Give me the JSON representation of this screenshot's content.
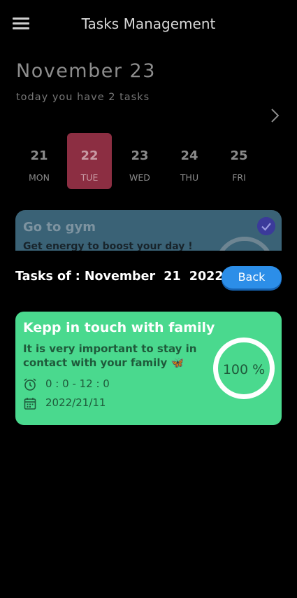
{
  "app": {
    "title": "Tasks Management"
  },
  "header": {
    "date": "November 23",
    "subtitle": "today you have 2 tasks"
  },
  "days": [
    {
      "num": "21",
      "dow": "MON",
      "selected": false
    },
    {
      "num": "22",
      "dow": "TUE",
      "selected": true
    },
    {
      "num": "23",
      "dow": "WED",
      "selected": false
    },
    {
      "num": "24",
      "dow": "THU",
      "selected": false
    },
    {
      "num": "25",
      "dow": "FRI",
      "selected": false
    }
  ],
  "peek_card": {
    "title": "Go to gym",
    "description": "Get energy to boost your day !"
  },
  "overlay": {
    "title": "Tasks of : November  21  2022",
    "back_label": "Back"
  },
  "task": {
    "title": "Kepp in touch with family",
    "description": "It is very important to stay in contact with your family 🦋",
    "time": "0 : 0 - 12 : 0",
    "date": "2022/21/11",
    "progress_text": "100 %",
    "progress": 1.0
  },
  "colors": {
    "background": "#000000",
    "selected_day": "#8c2e42",
    "peek_card": "#3a6276",
    "task_card": "#4ad98e",
    "back_button": "#2c8ee8"
  },
  "icons": {
    "menu": "menu-icon",
    "next": "chevron-right-icon",
    "done": "check-icon",
    "time": "alarm-clock-icon",
    "date": "calendar-icon"
  }
}
